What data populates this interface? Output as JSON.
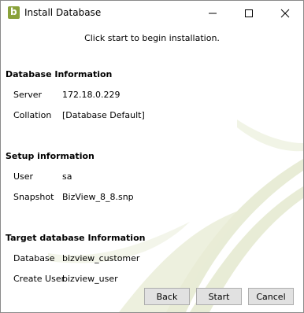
{
  "window": {
    "title": "Install Database",
    "app_icon_letter": "b",
    "controls": {
      "minimize_icon": "minimize-icon",
      "maximize_icon": "maximize-icon",
      "close_icon": "close-icon"
    }
  },
  "intro": "Click start to begin installation.",
  "database_info": {
    "heading": "Database Information",
    "server_label": "Server",
    "server_value": "172.18.0.229",
    "collation_label": "Collation",
    "collation_value": "[Database Default]"
  },
  "setup_info": {
    "heading": "Setup information",
    "user_label": "User",
    "user_value": "sa",
    "snapshot_label": "Snapshot",
    "snapshot_value": "BizView_8_8.snp"
  },
  "target_info": {
    "heading": "Target database Information",
    "database_label": "Database",
    "database_value": "bizview_customer",
    "create_user_label": "Create User",
    "create_user_value": "bizview_user"
  },
  "buttons": {
    "back": "Back",
    "start": "Start",
    "cancel": "Cancel"
  },
  "colors": {
    "brand": "#8aa23b",
    "decor": "#e8ecd6"
  }
}
